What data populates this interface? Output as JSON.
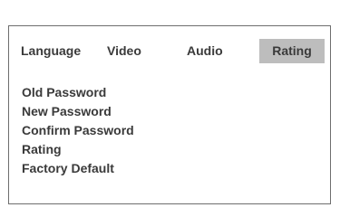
{
  "tabs": [
    {
      "label": "Language"
    },
    {
      "label": "Video"
    },
    {
      "label": "Audio"
    },
    {
      "label": "Rating",
      "selected": true
    }
  ],
  "menu": {
    "items": [
      {
        "label": "Old Password"
      },
      {
        "label": "New Password"
      },
      {
        "label": "Confirm Password"
      },
      {
        "label": "Rating"
      },
      {
        "label": "Factory Default"
      }
    ]
  },
  "colors": {
    "selected_tab_bg": "#bdbdbd",
    "text": "#3a3a3a",
    "border": "#6e6e6e"
  }
}
